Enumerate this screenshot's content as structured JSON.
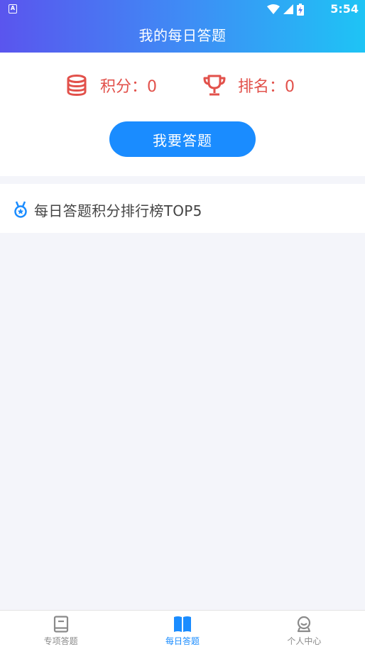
{
  "status_bar": {
    "notification_glyph": "A",
    "time": "5:54"
  },
  "header": {
    "title": "我的每日答题"
  },
  "stats": {
    "score_label": "积分：0",
    "rank_label": "排名：0"
  },
  "answer_button": {
    "label": "我要答题"
  },
  "leaderboard": {
    "title": "每日答题积分排行榜TOP5"
  },
  "bottom_nav": {
    "items": [
      {
        "label": "专项答题",
        "icon": "book-icon",
        "active": false
      },
      {
        "label": "每日答题",
        "icon": "open-book-icon",
        "active": true
      },
      {
        "label": "个人中心",
        "icon": "user-icon",
        "active": false
      }
    ]
  },
  "colors": {
    "accent": "#1a8cff",
    "stat_red": "#e2514b",
    "header_gradient_start": "#5a55ee",
    "header_gradient_end": "#1ec4f5"
  }
}
